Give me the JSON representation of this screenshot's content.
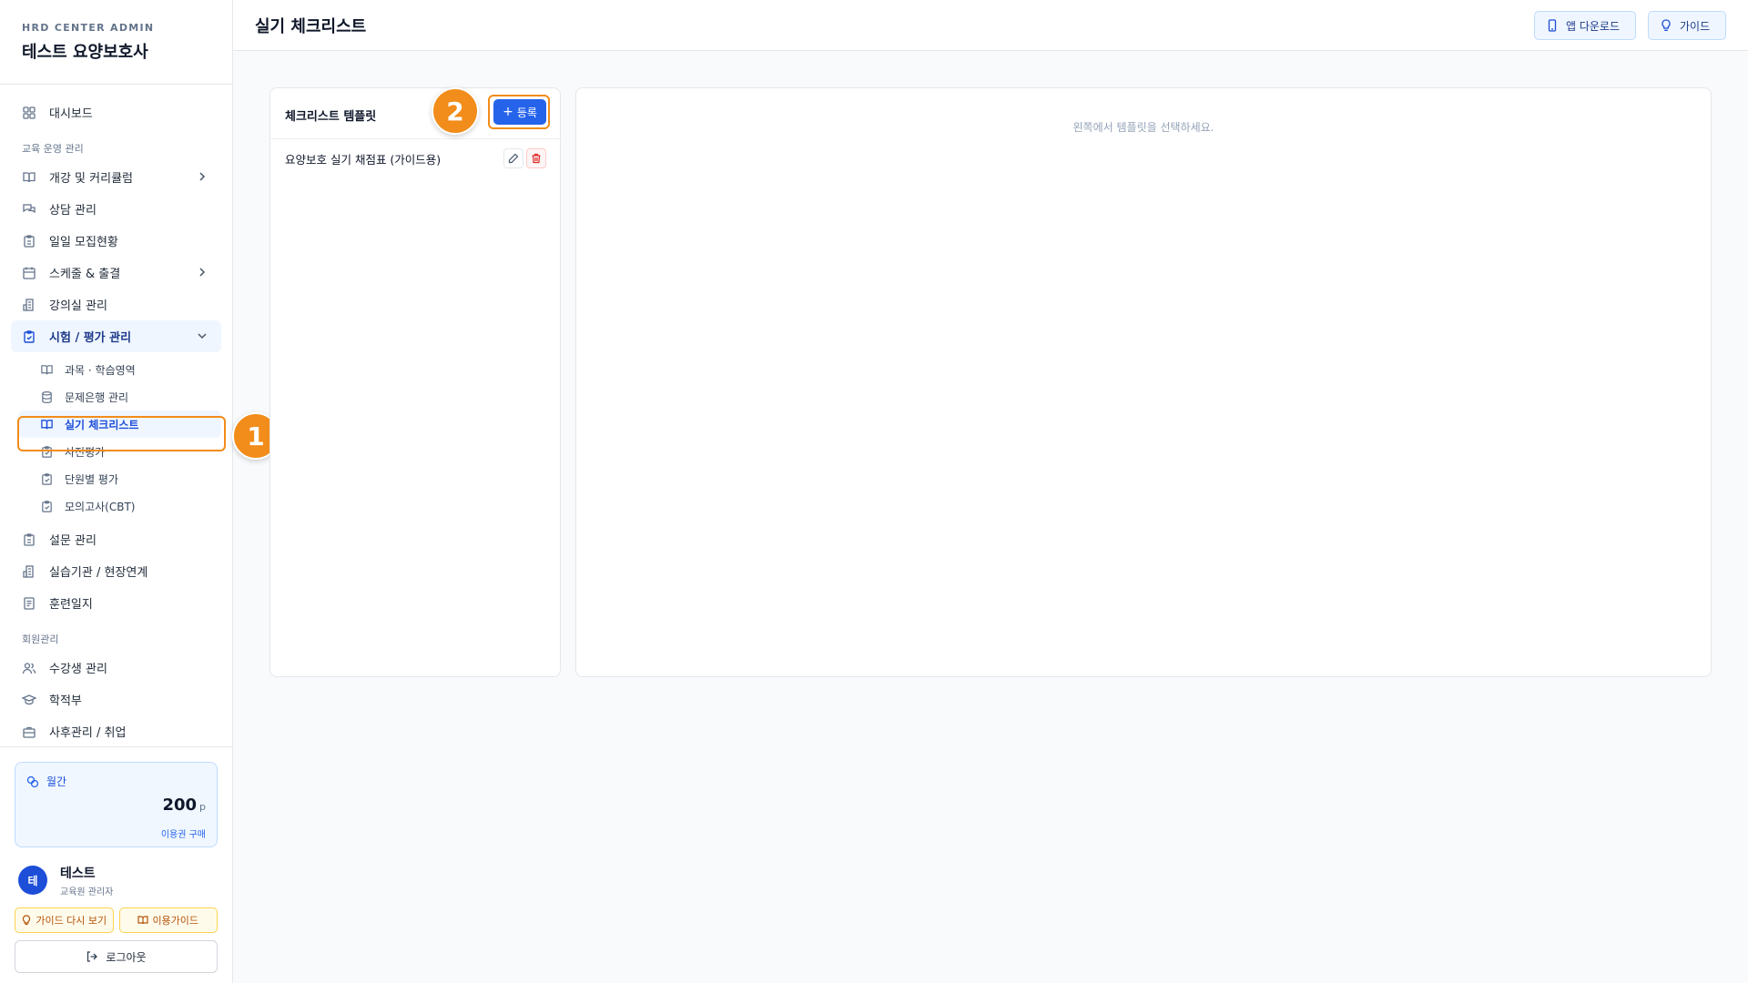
{
  "brand": {
    "sub": "HRD CENTER ADMIN",
    "title": "테스트 요양보호사"
  },
  "nav": {
    "dashboard": "대시보드",
    "section_edu": "교육 운영 관리",
    "course": "개강 및 커리큘럼",
    "consult": "상담 관리",
    "recruit": "일일 모집현황",
    "schedule": "스케줄 & 출결",
    "classroom": "강의실 관리",
    "exam": "시험 / 평가 관리",
    "sub": {
      "subject": "과목 · 학습영역",
      "bank": "문제은행 관리",
      "checklist": "실기 체크리스트",
      "pretest": "사전평가",
      "unit": "단원별 평가",
      "mock": "모의고사(CBT)"
    },
    "survey": "설문 관리",
    "practice": "실습기관 / 현장연계",
    "journal": "훈련일지",
    "section_member": "회원관리",
    "students": "수강생 관리",
    "records": "학적부",
    "aftercare": "사후관리 / 취업"
  },
  "points": {
    "label": "월간",
    "value": "200",
    "unit": "p",
    "buy": "이용권 구매"
  },
  "user": {
    "initial": "테",
    "name": "테스트",
    "role": "교육원 관리자"
  },
  "guide": {
    "replay": "가이드 다시 보기",
    "usage": "이용가이드"
  },
  "logout": "로그아웃",
  "header": {
    "title": "실기 체크리스트",
    "app_download": "앱 다운로드",
    "guide": "가이드"
  },
  "templates": {
    "title": "체크리스트 템플릿",
    "add_label": "등록",
    "items": [
      {
        "name": "요양보호 실기 채점표 (가이드용)"
      }
    ]
  },
  "detail": {
    "empty": "왼쪽에서 템플릿을 선택하세요."
  },
  "annotations": {
    "step1": "1",
    "step2": "2"
  },
  "colors": {
    "accent": "#2563eb",
    "highlight": "#f28c1a",
    "danger": "#dc2626"
  }
}
